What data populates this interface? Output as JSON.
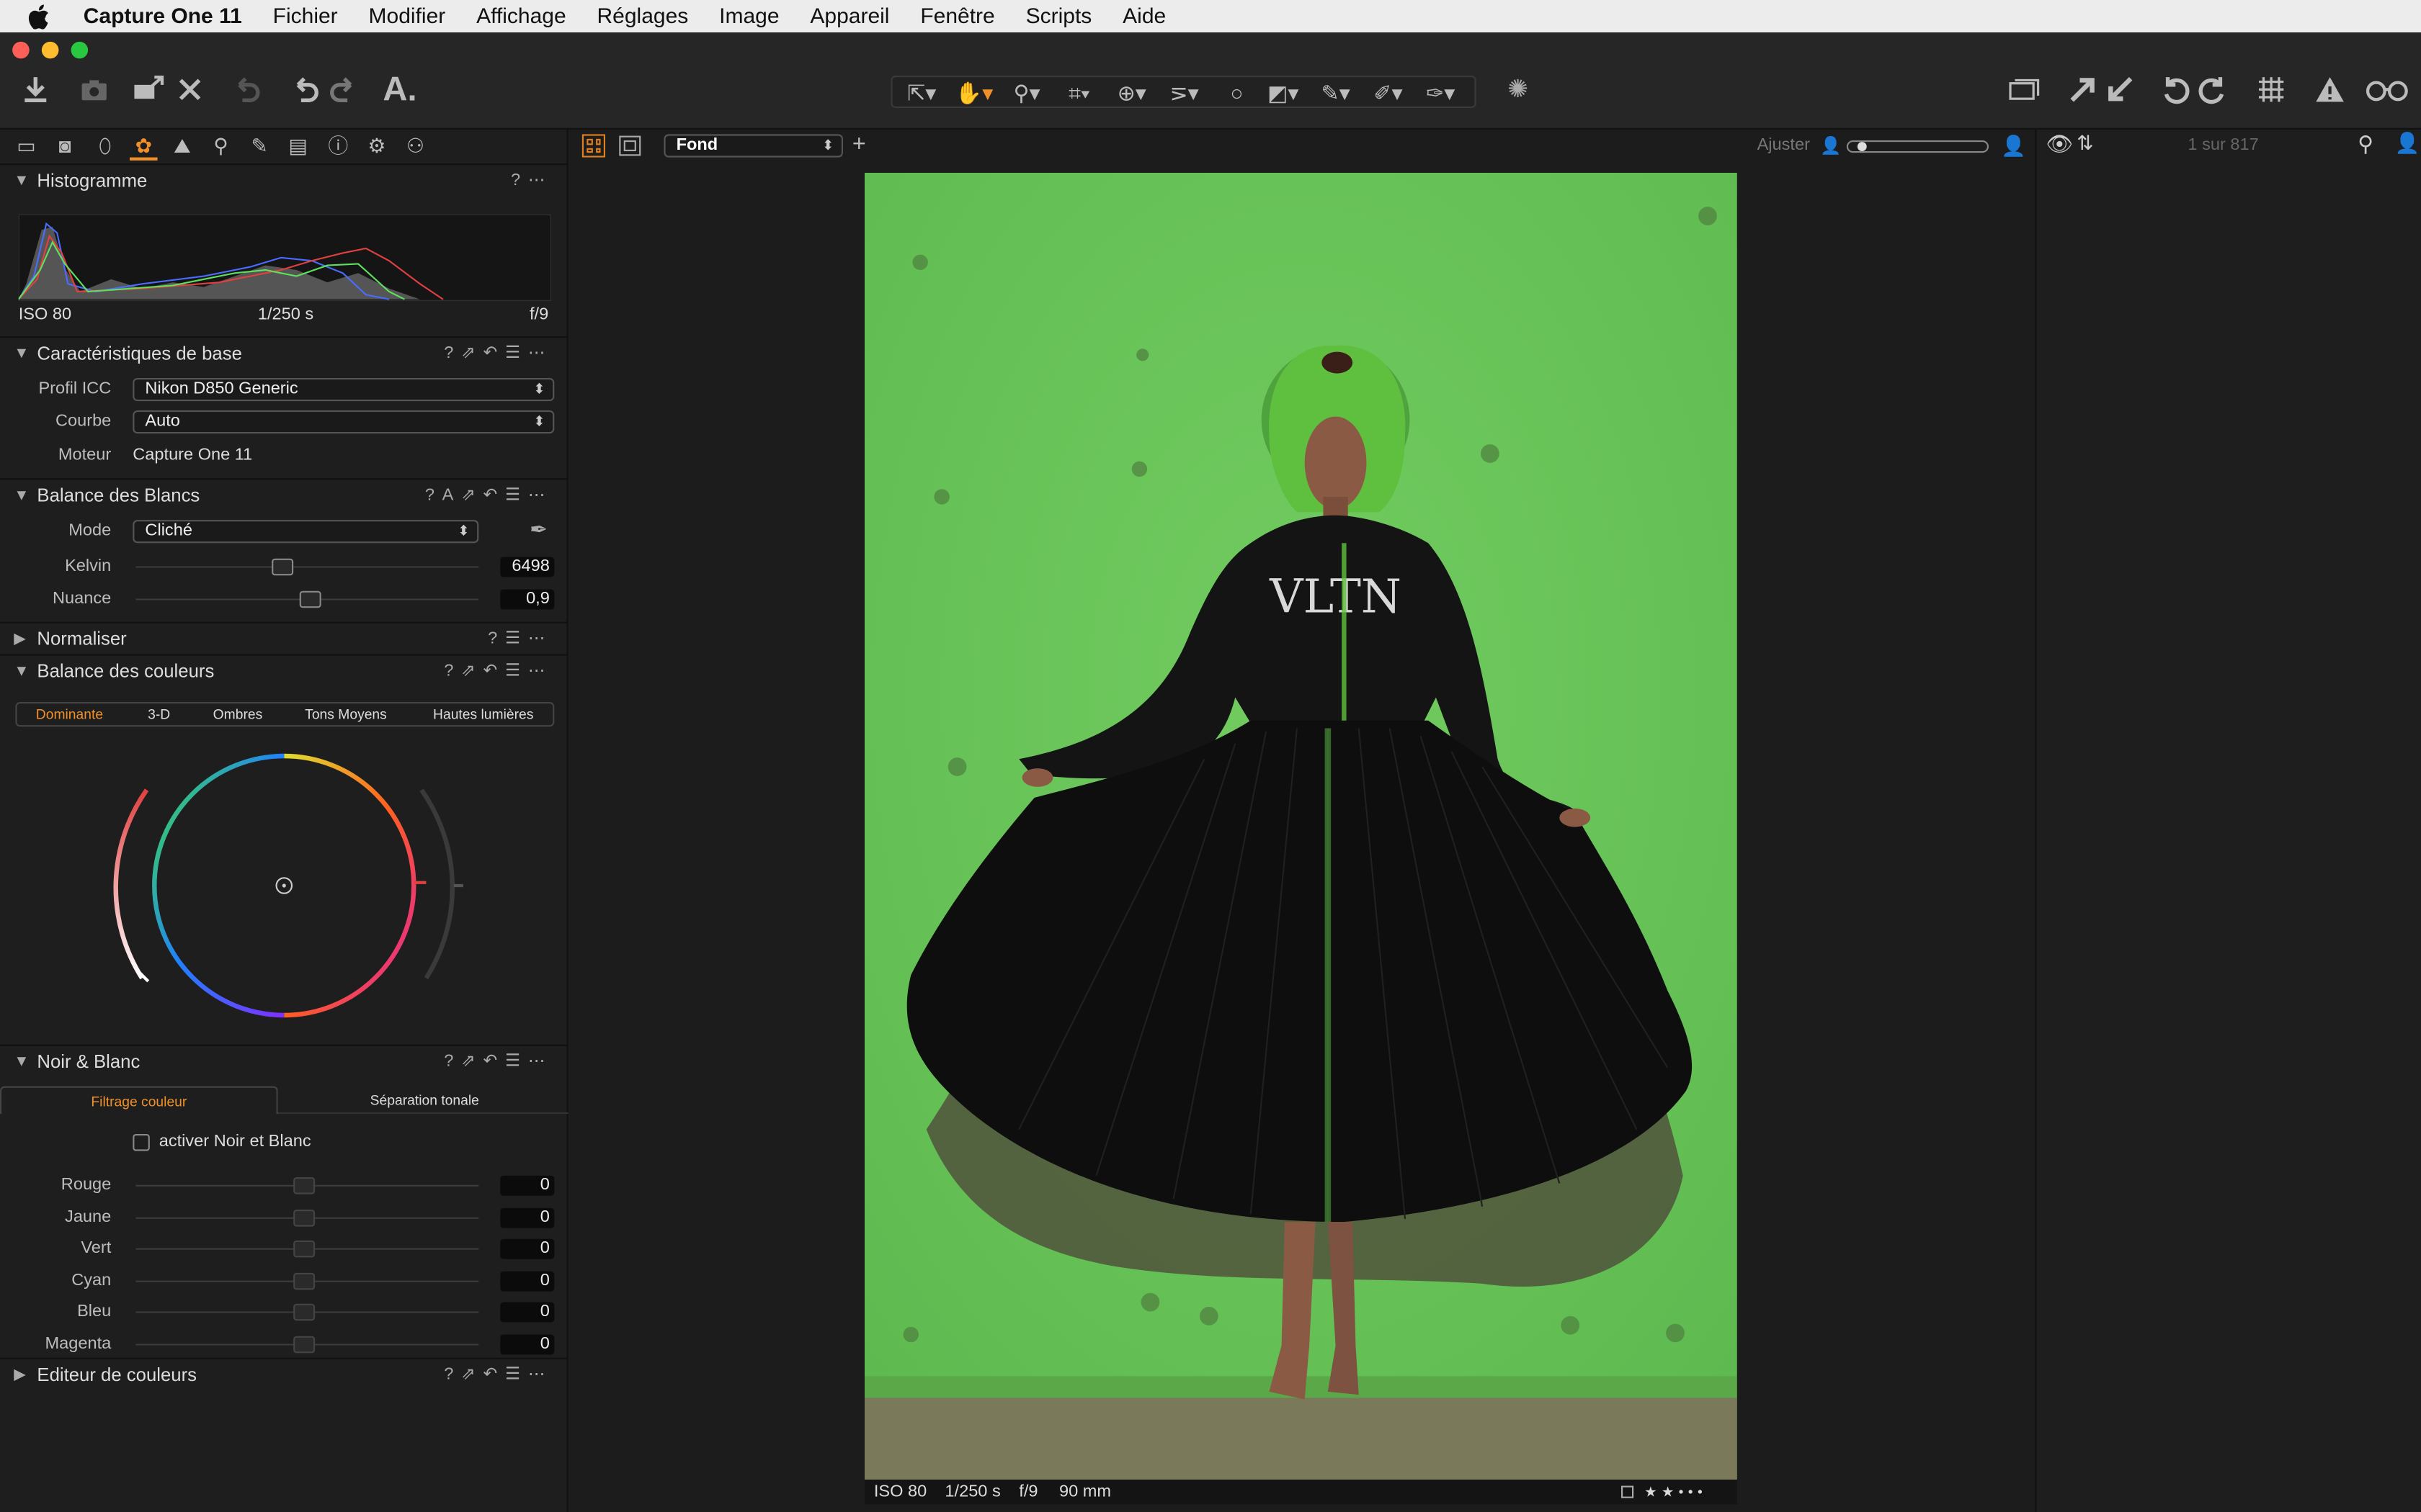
{
  "menubar": {
    "app": "Capture One 11",
    "items": [
      "Fichier",
      "Modifier",
      "Affichage",
      "Réglages",
      "Image",
      "Appareil",
      "Fenêtre",
      "Scripts",
      "Aide"
    ]
  },
  "toolbar": {
    "text_tool": "A.",
    "icons_left": [
      "import-icon",
      "camera-icon",
      "export-icon",
      "delete-icon",
      "undo-history-icon",
      "undo-icon",
      "redo-icon"
    ],
    "cursor_tools": [
      "select-cursor-icon",
      "hand-icon",
      "zoom-icon",
      "crop-icon",
      "rotate-icon",
      "keystone-icon",
      "circle-spot-icon",
      "mask-icon",
      "picker-icon",
      "brush-icon",
      "eraser-icon"
    ],
    "icons_right": [
      "layers-icon",
      "before-icon",
      "after-icon",
      "rotate-left-icon",
      "rotate-right-icon",
      "grid-icon",
      "warning-icon",
      "glasses-icon"
    ]
  },
  "histogram": {
    "title": "Histogramme",
    "iso": "ISO 80",
    "shutter": "1/250 s",
    "aperture": "f/9"
  },
  "basic": {
    "title": "Caractéristiques de base",
    "icc_label": "Profil ICC",
    "icc_value": "Nikon D850 Generic",
    "curve_label": "Courbe",
    "curve_value": "Auto",
    "engine_label": "Moteur",
    "engine_value": "Capture One 11"
  },
  "wb": {
    "title": "Balance des Blancs",
    "mode_label": "Mode",
    "mode_value": "Cliché",
    "kelvin_label": "Kelvin",
    "kelvin_value": "6498",
    "tint_label": "Nuance",
    "tint_value": "0,9",
    "kelvin_pos": 0.43,
    "tint_pos": 0.51
  },
  "normalize": {
    "title": "Normaliser"
  },
  "colorbalance": {
    "title": "Balance des couleurs",
    "tabs": [
      "Dominante",
      "3-D",
      "Ombres",
      "Tons Moyens",
      "Hautes lumières"
    ],
    "active_tab": "Dominante",
    "accent": "#f0902a"
  },
  "bw": {
    "title": "Noir & Blanc",
    "tab1": "Filtrage couleur",
    "tab2": "Séparation tonale",
    "enable_label": "activer Noir et Blanc",
    "sliders": [
      {
        "label": "Rouge",
        "value": "0"
      },
      {
        "label": "Jaune",
        "value": "0"
      },
      {
        "label": "Vert",
        "value": "0"
      },
      {
        "label": "Cyan",
        "value": "0"
      },
      {
        "label": "Bleu",
        "value": "0"
      },
      {
        "label": "Magenta",
        "value": "0"
      }
    ]
  },
  "coloreditor": {
    "title": "Editeur de couleurs"
  },
  "viewer": {
    "style_value": "Fond",
    "adjust_label": "Ajuster",
    "photo_text": "VLTN",
    "info": {
      "iso": "ISO 80",
      "shutter": "1/250 s",
      "aperture": "f/9",
      "focal": "90 mm"
    },
    "rating": "★★•••"
  },
  "browser": {
    "count": "1 sur 817"
  }
}
